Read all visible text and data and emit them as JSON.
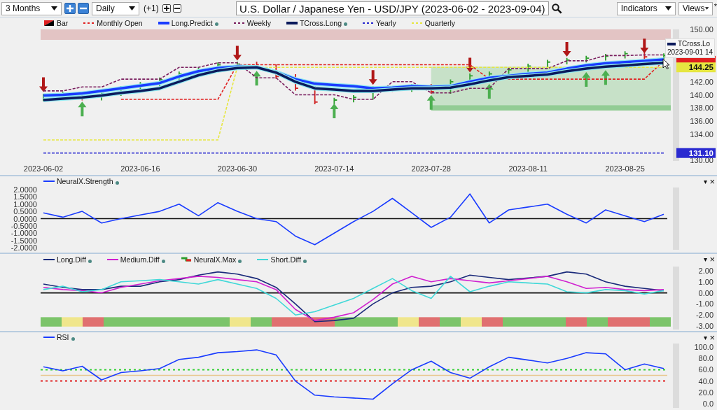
{
  "toolbar": {
    "range": "3 Months",
    "interval": "Daily",
    "offset": "(+1)",
    "title": "U.S. Dollar / Japanese Yen - USD/JPY (2023-06-02 - 2023-09-04)",
    "indicators": "Indicators",
    "views": "Views",
    "marker": "*"
  },
  "panels": [
    {
      "kind": "price",
      "lines": [
        {
          "kind": "bar",
          "label": "Bar",
          "dot": false
        },
        {
          "kind": "line",
          "dot": false
        },
        {
          "kind": "thick",
          "dot": true
        },
        {
          "kind": "line",
          "dot": false
        },
        {
          "kind": "thick",
          "dot": true
        },
        {
          "kind": "line",
          "dot": false
        },
        {
          "kind": "line",
          "dot": false
        }
      ],
      "signals": [
        {
          "kind": "sell"
        },
        {
          "kind": "none"
        },
        {
          "kind": "buy"
        },
        {
          "kind": "none"
        },
        {
          "kind": "none"
        },
        {
          "kind": "none"
        },
        {
          "kind": "none"
        },
        {
          "kind": "none"
        },
        {
          "kind": "none"
        },
        {
          "kind": "none"
        },
        {
          "kind": "sell"
        },
        {
          "kind": "buy"
        },
        {
          "kind": "none"
        },
        {
          "kind": "none"
        },
        {
          "kind": "none"
        },
        {
          "kind": "buy"
        },
        {
          "kind": "none"
        },
        {
          "kind": "sell"
        },
        {
          "kind": "none"
        },
        {
          "kind": "none"
        },
        {
          "kind": "buy"
        },
        {
          "kind": "none"
        },
        {
          "kind": "sell"
        },
        {
          "kind": "buy"
        },
        {
          "kind": "none"
        },
        {
          "kind": "none"
        },
        {
          "kind": "none"
        },
        {
          "kind": "sell"
        },
        {
          "kind": "buy"
        },
        {
          "kind": "buy"
        },
        {
          "kind": "none"
        },
        {
          "kind": "sell"
        },
        {
          "kind": "none"
        }
      ],
      "tooltip": {
        "label": "TCross.Lo",
        "value": "2023-09-01 14",
        "color": "#0b1a5c"
      },
      "chart_data": {
        "type": "line",
        "categories": [
          "2023-06-02",
          null,
          null,
          null,
          null,
          "2023-06-16",
          null,
          null,
          null,
          null,
          "2023-06-30",
          null,
          null,
          null,
          null,
          "2023-07-14",
          null,
          null,
          null,
          null,
          "2023-07-28",
          null,
          null,
          null,
          null,
          "2023-08-11",
          null,
          null,
          null,
          null,
          "2023-08-25",
          null,
          null
        ],
        "ylim": [
          130,
          150
        ],
        "yticks": [
          {
            "value": 150,
            "label": "150.00"
          },
          {
            "value": 142,
            "label": "142.00"
          },
          {
            "value": 140,
            "label": "140.00"
          },
          {
            "value": 138,
            "label": "138.00"
          },
          {
            "value": 136,
            "label": "136.00"
          },
          {
            "value": 134,
            "label": "134.00"
          },
          {
            "value": 130,
            "label": "130.00"
          }
        ],
        "series": [
          {
            "name": "Monthly Open",
            "color": "#e02020",
            "line_style": "dashed",
            "values": [
              null,
              null,
              null,
              null,
              139.3,
              139.3,
              139.3,
              139.3,
              139.3,
              139.3,
              144.6,
              144.6,
              144.6,
              144.6,
              144.6,
              144.6,
              144.6,
              144.6,
              144.6,
              144.6,
              144.6,
              144.6,
              144.6,
              142.4,
              142.4,
              142.4,
              142.4,
              142.4,
              142.4,
              142.4,
              142.4,
              142.4,
              145.2
            ]
          },
          {
            "name": "Long.Predict",
            "color": "#1a3cff",
            "values": [
              139.9,
              140.0,
              140.2,
              140.6,
              141.0,
              141.4,
              141.8,
              142.8,
              143.6,
              144.1,
              144.3,
              144.2,
              143.5,
              142.4,
              141.7,
              141.5,
              141.3,
              141.0,
              141.1,
              141.3,
              141.2,
              141.3,
              142.0,
              142.6,
              142.9,
              143.2,
              143.4,
              144.0,
              144.5,
              144.8,
              145.0,
              145.2,
              145.4
            ]
          },
          {
            "name": "Weekly",
            "color": "#7a1f5f",
            "line_style": "dashed",
            "values": [
              140.6,
              140.6,
              141.2,
              141.2,
              142.4,
              142.4,
              142.4,
              144.2,
              144.2,
              144.9,
              144.9,
              142.6,
              142.6,
              140.0,
              140.0,
              140.0,
              139.3,
              139.3,
              142.0,
              142.0,
              140.3,
              140.3,
              141.0,
              141.0,
              144.0,
              144.0,
              144.0,
              145.2,
              145.2,
              146.0,
              146.0,
              146.1,
              146.1
            ]
          },
          {
            "name": "TCross.Long",
            "color": "#0b1a5c",
            "values": [
              139.2,
              139.4,
              139.6,
              139.9,
              140.3,
              140.6,
              141.0,
              142.0,
              143.0,
              143.7,
              144.1,
              144.2,
              143.4,
              142.0,
              141.0,
              140.8,
              140.6,
              140.6,
              140.8,
              141.0,
              141.0,
              141.1,
              141.6,
              142.2,
              142.7,
              142.9,
              143.1,
              143.6,
              144.0,
              144.3,
              144.5,
              144.7,
              144.9
            ]
          },
          {
            "name": "Yearly",
            "color": "#2a2ad0",
            "line_style": "dashed",
            "values": [
              131.1,
              131.1,
              131.1,
              131.1,
              131.1,
              131.1,
              131.1,
              131.1,
              131.1,
              131.1,
              131.1,
              131.1,
              131.1,
              131.1,
              131.1,
              131.1,
              131.1,
              131.1,
              131.1,
              131.1,
              131.1,
              131.1,
              131.1,
              131.1,
              131.1,
              131.1,
              131.1,
              131.1,
              131.1,
              131.1,
              131.1,
              131.1,
              131.1
            ]
          },
          {
            "name": "Quarterly",
            "color": "#e6e640",
            "line_style": "dashed",
            "values": [
              133.1,
              133.1,
              133.1,
              133.1,
              133.1,
              133.1,
              133.1,
              133.1,
              133.1,
              133.1,
              144.2,
              144.2,
              144.2,
              144.2,
              144.2,
              144.2,
              144.2,
              144.2,
              144.2,
              144.2,
              144.2,
              144.2,
              144.2,
              144.2,
              144.2,
              144.2,
              144.2,
              144.2,
              null,
              null,
              144.2,
              144.2,
              144.2
            ]
          }
        ],
        "annotations": [
          "144.25",
          "131.10"
        ]
      }
    },
    {
      "kind": "indicator",
      "controls": [
        {
          "kind": "menu",
          "text": "▾"
        },
        {
          "kind": "close",
          "text": "×"
        }
      ],
      "lines": [
        {
          "kind": "line",
          "dot": true
        }
      ],
      "chart_data": {
        "type": "line",
        "categories": [
          null,
          null,
          null,
          null,
          null,
          null,
          null,
          null,
          null,
          null,
          null,
          null,
          null,
          null,
          null,
          null,
          null,
          null,
          null,
          null,
          null,
          null,
          null,
          null,
          null,
          null,
          null,
          null,
          null,
          null,
          null,
          null,
          null
        ],
        "ylim": [
          -2,
          2
        ],
        "yticks": [
          {
            "value": 2,
            "label": "2.0000"
          },
          {
            "value": 1.5,
            "label": "1.5000"
          },
          {
            "value": 1,
            "label": "1.0000"
          },
          {
            "value": 0.5,
            "label": "0.5000"
          },
          {
            "value": 0,
            "label": "0.0000"
          },
          {
            "value": -0.5,
            "label": "-0.5000"
          },
          {
            "value": -1,
            "label": "-1.0000"
          },
          {
            "value": -1.5,
            "label": "-1.5000"
          },
          {
            "value": -2,
            "label": "-2.0000"
          }
        ],
        "series": [
          {
            "name": "NeuralX.Strength",
            "color": "#1a3cff",
            "values": [
              0.4,
              0.1,
              0.5,
              -0.3,
              0.0,
              0.25,
              0.5,
              1.0,
              0.2,
              1.1,
              0.5,
              0.0,
              -0.2,
              -1.2,
              -1.8,
              -1.0,
              -0.2,
              0.5,
              1.4,
              0.4,
              -0.6,
              0.1,
              1.7,
              -0.3,
              0.6,
              0.8,
              1.0,
              0.3,
              -0.3,
              0.6,
              0.2,
              -0.2,
              0.3
            ]
          }
        ],
        "ref_lines": [
          {
            "axis": "y",
            "value": 0,
            "color": "#111111"
          }
        ]
      }
    },
    {
      "kind": "indicator",
      "controls": [
        {
          "kind": "menu",
          "text": "▾"
        },
        {
          "kind": "close",
          "text": "×"
        }
      ],
      "lines": [
        {
          "kind": "line",
          "dot": true
        },
        {
          "kind": "line",
          "dot": true
        },
        {
          "kind": "step",
          "label": "NeuralX.Max",
          "dot": true
        },
        {
          "kind": "line",
          "dot": true
        }
      ],
      "strip": [
        {
          "color": "#7cc46a"
        },
        {
          "color": "#f0e68c"
        },
        {
          "color": "#e07070"
        },
        {
          "color": "#7cc46a"
        },
        {
          "color": "#7cc46a"
        },
        {
          "color": "#7cc46a"
        },
        {
          "color": "#7cc46a"
        },
        {
          "color": "#7cc46a"
        },
        {
          "color": "#7cc46a"
        },
        {
          "color": "#f0e68c"
        },
        {
          "color": "#7cc46a"
        },
        {
          "color": "#e07070"
        },
        {
          "color": "#e07070"
        },
        {
          "color": "#e07070"
        },
        {
          "color": "#7cc46a"
        },
        {
          "color": "#7cc46a"
        },
        {
          "color": "#7cc46a"
        },
        {
          "color": "#f0e68c"
        },
        {
          "color": "#e07070"
        },
        {
          "color": "#7cc46a"
        },
        {
          "color": "#f0e68c"
        },
        {
          "color": "#e07070"
        },
        {
          "color": "#7cc46a"
        },
        {
          "color": "#7cc46a"
        },
        {
          "color": "#7cc46a"
        },
        {
          "color": "#e07070"
        },
        {
          "color": "#7cc46a"
        },
        {
          "color": "#e07070"
        },
        {
          "color": "#e07070"
        },
        {
          "color": "#7cc46a"
        }
      ],
      "chart_data": {
        "type": "line",
        "categories": [
          null,
          null,
          null,
          null,
          null,
          null,
          null,
          null,
          null,
          null,
          null,
          null,
          null,
          null,
          null,
          null,
          null,
          null,
          null,
          null,
          null,
          null,
          null,
          null,
          null,
          null,
          null,
          null,
          null,
          null,
          null,
          null,
          null
        ],
        "ylim": [
          -3,
          2
        ],
        "yticks": [
          {
            "value": 2,
            "label": "2.00"
          },
          {
            "value": 1,
            "label": "1.00"
          },
          {
            "value": 0,
            "label": "0.00"
          },
          {
            "value": -1,
            "label": "-1.00"
          },
          {
            "value": -2,
            "label": "-2.00"
          },
          {
            "value": -3,
            "label": "-3.00"
          }
        ],
        "series": [
          {
            "name": "Long.Diff",
            "color": "#1a2a7a",
            "values": [
              0.8,
              0.5,
              0.3,
              0.3,
              0.6,
              0.6,
              1.0,
              1.2,
              1.6,
              1.9,
              1.7,
              1.3,
              0.5,
              -1.0,
              -2.6,
              -2.5,
              -2.3,
              -1.0,
              0.0,
              0.5,
              0.6,
              1.0,
              1.6,
              1.4,
              1.2,
              1.35,
              1.5,
              1.9,
              1.7,
              1.0,
              0.6,
              0.4,
              0.2
            ]
          },
          {
            "name": "Medium.Diff",
            "color": "#d020d0",
            "values": [
              0.5,
              0.3,
              0.2,
              0.0,
              0.5,
              0.8,
              1.1,
              1.3,
              1.5,
              1.4,
              1.2,
              1.0,
              0.3,
              -1.5,
              -2.5,
              -2.2,
              -1.8,
              -0.6,
              0.8,
              1.5,
              1.0,
              1.3,
              1.1,
              0.9,
              1.1,
              1.3,
              1.5,
              1.0,
              0.4,
              0.5,
              0.3,
              0.2,
              0.3
            ]
          },
          {
            "name": "Short.Diff",
            "color": "#40d8d8",
            "values": [
              0.3,
              0.6,
              0.1,
              0.3,
              1.0,
              1.1,
              1.2,
              1.0,
              0.8,
              1.2,
              0.8,
              0.4,
              -0.5,
              -2.0,
              -1.7,
              -1.1,
              -0.5,
              0.4,
              1.3,
              0.2,
              -0.5,
              1.5,
              0.1,
              0.6,
              1.0,
              0.9,
              0.8,
              0.1,
              0.0,
              0.3,
              0.2,
              -0.1,
              0.2
            ]
          }
        ],
        "ref_lines": [
          {
            "axis": "y",
            "value": 0,
            "color": "#111111"
          }
        ]
      }
    },
    {
      "kind": "indicator",
      "controls": [
        {
          "kind": "menu",
          "text": "▾"
        },
        {
          "kind": "close",
          "text": "×"
        }
      ],
      "lines": [
        {
          "kind": "line",
          "dot": true
        }
      ],
      "chart_data": {
        "type": "line",
        "categories": [
          null,
          null,
          null,
          null,
          null,
          null,
          null,
          null,
          null,
          null,
          null,
          null,
          null,
          null,
          null,
          null,
          null,
          null,
          null,
          null,
          null,
          null,
          null,
          null,
          null,
          null,
          null,
          null,
          null,
          null,
          null,
          null,
          null
        ],
        "ylim": [
          0,
          100
        ],
        "yticks": [
          {
            "value": 100,
            "label": "100.0"
          },
          {
            "value": 80,
            "label": "80.0"
          },
          {
            "value": 60,
            "label": "60.0"
          },
          {
            "value": 40,
            "label": "40.0"
          },
          {
            "value": 20,
            "label": "20.0"
          },
          {
            "value": 0,
            "label": "0.0"
          }
        ],
        "series": [
          {
            "name": "RSI",
            "color": "#1a3cff",
            "values": [
              65,
              58,
              66,
              42,
              55,
              58,
              62,
              78,
              82,
              90,
              92,
              95,
              86,
              40,
              15,
              12,
              10,
              8,
              35,
              60,
              75,
              55,
              45,
              65,
              82,
              77,
              72,
              80,
              90,
              88,
              60,
              70,
              62
            ]
          }
        ],
        "ref_lines": [
          {
            "axis": "y",
            "value": 50,
            "color": "#e8c890"
          },
          {
            "axis": "y",
            "value": 60,
            "color": "#30d030"
          },
          {
            "axis": "y",
            "value": 40,
            "color": "#e02020"
          }
        ]
      }
    }
  ]
}
